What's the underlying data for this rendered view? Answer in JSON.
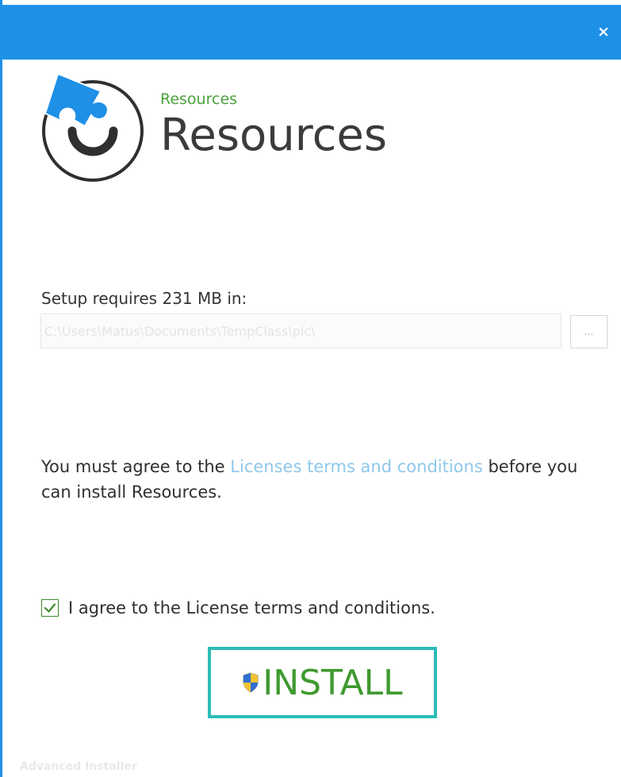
{
  "window": {
    "close_glyph": "×"
  },
  "header": {
    "logo_icon": "puzzle-piece-icon",
    "subtitle": "Resources",
    "title": "Resources"
  },
  "install_location": {
    "label": "Setup requires 231 MB in:",
    "path_value": "C:\\Users\\Matus\\Documents\\TempClass\\pic\\",
    "browse_label": "..."
  },
  "license": {
    "text_before": "You must agree to the ",
    "link_text": "Licenses terms and conditions",
    "text_after": " before you can install Resources."
  },
  "agreement": {
    "checked": true,
    "label": "I agree to the License terms and conditions."
  },
  "install_button": {
    "label": "INSTALL",
    "icon": "uac-shield-icon"
  },
  "footer": {
    "brand": "Advanced Installer"
  },
  "colors": {
    "titlebar": "#1e90e6",
    "accent_green": "#3f9a2f",
    "link": "#8fc8ea",
    "button_border": "#2dbcb6"
  }
}
